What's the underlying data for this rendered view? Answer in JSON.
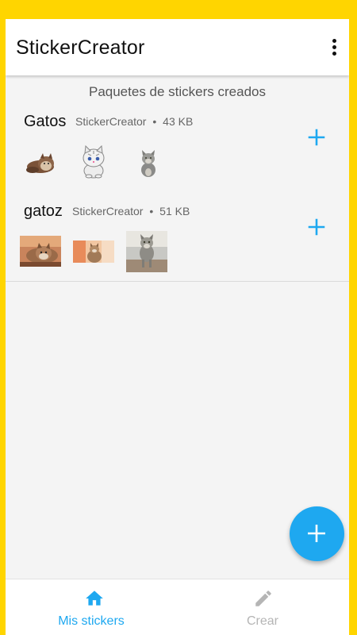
{
  "app_bar": {
    "title": "StickerCreator",
    "menu_icon": "more-vert-icon"
  },
  "section_header": "Paquetes de stickers creados",
  "packs": [
    {
      "name": "Gatos",
      "publisher": "StickerCreator",
      "size": "43 KB",
      "separator": "•",
      "stickers": [
        "cat-lying-sticker",
        "cartoon-kitten-sticker",
        "grey-cat-sitting-sticker"
      ],
      "action_icon": "add-icon"
    },
    {
      "name": "gatoz",
      "publisher": "StickerCreator",
      "size": "51 KB",
      "separator": "•",
      "stickers": [
        "cat-photo-lying-sticker",
        "cat-photo-sitting-sticker",
        "cat-photo-walking-sticker"
      ],
      "action_icon": "add-icon"
    }
  ],
  "fab": {
    "icon": "add-icon"
  },
  "bottom_nav": {
    "items": [
      {
        "label": "Mis stickers",
        "icon": "home-icon",
        "active": true
      },
      {
        "label": "Crear",
        "icon": "pencil-icon",
        "active": false
      }
    ]
  },
  "colors": {
    "frame": "#FFD500",
    "accent": "#1EA8F0",
    "active_nav": "#1EA8F0",
    "inactive_nav": "#B5B5B5"
  }
}
